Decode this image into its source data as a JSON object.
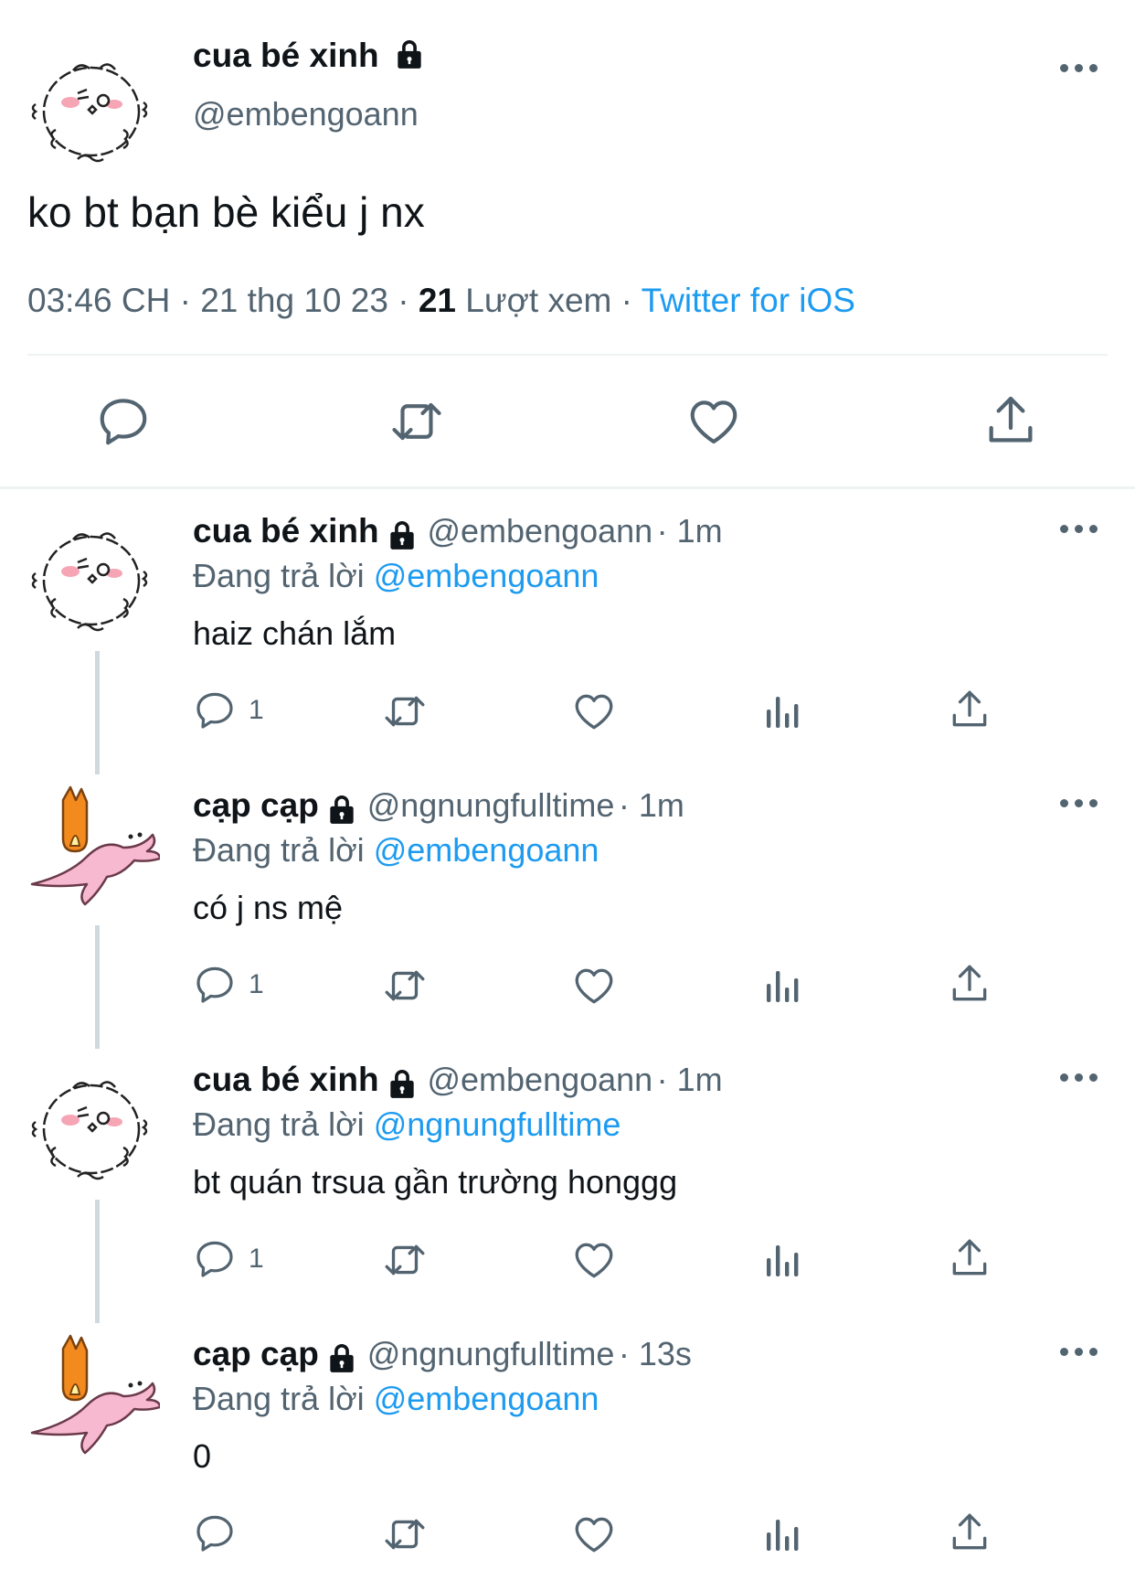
{
  "main_tweet": {
    "display_name": "cua bé xinh",
    "handle": "@embengoann",
    "text": "ko bt bạn bè kiểu j nx",
    "time": "03:46 CH",
    "date": "21 thg 10 23",
    "views_count": "21",
    "views_label": "Lượt xem",
    "source": "Twitter for iOS",
    "sep": "·"
  },
  "replies": [
    {
      "display_name": "cua bé xinh",
      "handle": "@embengoann",
      "age": "· 1m",
      "replying_label": "Đang trả lời",
      "replying_to": "@embengoann",
      "text": "haiz chán lắm",
      "reply_count": "1"
    },
    {
      "display_name": "cạp cạp",
      "handle": "@ngnungfulltime",
      "age": "· 1m",
      "replying_label": "Đang trả lời",
      "replying_to": "@embengoann",
      "text": "có j ns mệ",
      "reply_count": "1"
    },
    {
      "display_name": "cua bé xinh",
      "handle": "@embengoann",
      "age": "· 1m",
      "replying_label": "Đang trả lời",
      "replying_to": "@ngnungfulltime",
      "text": "bt quán trsua gần trường honggg",
      "reply_count": "1"
    },
    {
      "display_name": "cạp cạp",
      "handle": "@ngnungfulltime",
      "age": "· 13s",
      "replying_label": "Đang trả lời",
      "replying_to": "@embengoann",
      "text": "0",
      "reply_count": ""
    }
  ],
  "colors": {
    "text": "#0f1419",
    "secondary": "#536471",
    "link": "#1d9bf0",
    "divider": "#eff3f4"
  },
  "icons": [
    "lock-icon",
    "more-icon",
    "reply-icon",
    "retweet-icon",
    "like-icon",
    "views-icon",
    "share-icon"
  ]
}
